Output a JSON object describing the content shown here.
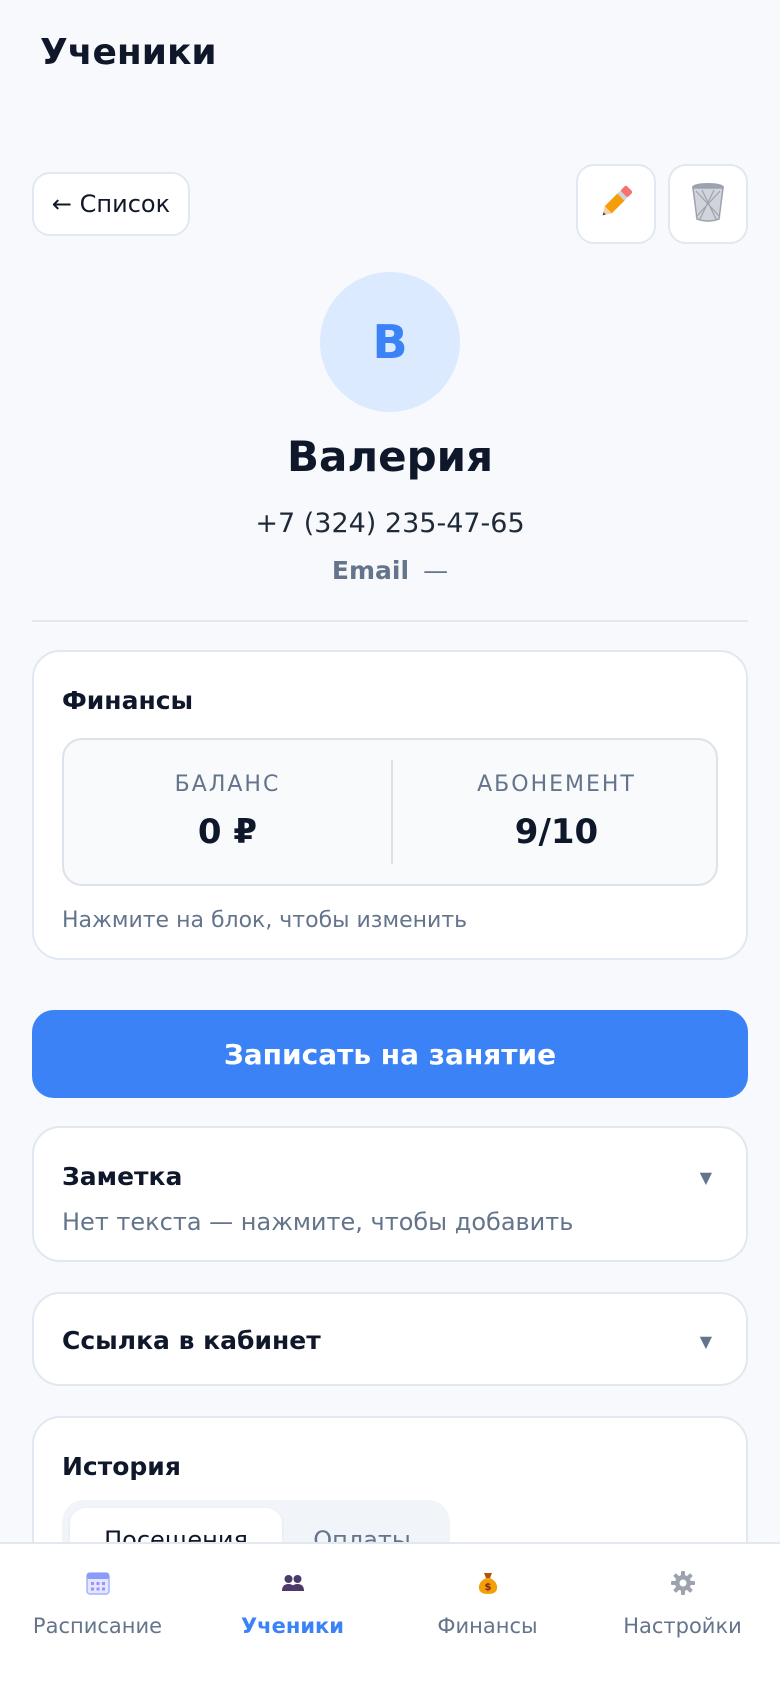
{
  "header": {
    "title": "Ученики"
  },
  "toolbar": {
    "back_label": "← Список",
    "edit_icon": "pencil-icon",
    "delete_icon": "wastebasket-icon"
  },
  "student": {
    "avatar_letter": "В",
    "name": "Валерия",
    "phone": "+7 (324) 235-47-65",
    "email_label": "Email",
    "email_value": "—"
  },
  "finances": {
    "title": "Финансы",
    "balance_label": "БАЛАНС",
    "balance_value": "0 ₽",
    "subscription_label": "АБОНЕМЕНТ",
    "subscription_value": "9/10",
    "hint": "Нажмите на блок, чтобы изменить"
  },
  "book_button": "Записать на занятие",
  "note": {
    "title": "Заметка",
    "text": "Нет текста — нажмите, чтобы добавить"
  },
  "cabinet_link": {
    "title": "Ссылка в кабинет"
  },
  "history": {
    "title": "История",
    "tabs": [
      "Посещения",
      "Оплаты"
    ],
    "active_tab": "Посещения"
  },
  "bottom_nav": {
    "items": [
      {
        "label": "Расписание",
        "icon": "calendar-icon"
      },
      {
        "label": "Ученики",
        "icon": "people-icon"
      },
      {
        "label": "Финансы",
        "icon": "money-bag-icon"
      },
      {
        "label": "Настройки",
        "icon": "gear-icon"
      }
    ],
    "active": "Ученики"
  },
  "colors": {
    "accent": "#3b82f6",
    "avatar_bg": "#dbeafe",
    "background": "#f7f9fc"
  }
}
